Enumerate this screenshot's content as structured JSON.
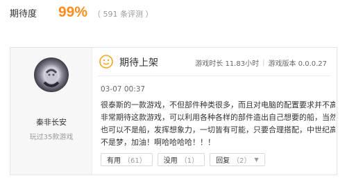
{
  "rating": {
    "label": "期待度",
    "value": "99%",
    "count_text": "（ 591 条评测 ）"
  },
  "review": {
    "user": {
      "name": "秦非长安",
      "played": "玩过35款游戏"
    },
    "status": "期待上架",
    "playtime": "游戏时长 11.83小时",
    "separator": "|",
    "version": "游戏版本 0.0.0.27",
    "date": "03-07 00:37",
    "content_lines": [
      "很泰斯的一款游戏，不但部件种类很多，而且对电脑的配置要求并不高，",
      "非常期待这款游戏，可以利用各种各样的部件造出自己想要的船，当然",
      "也可以不是船，发挥想象力，一切皆有可能，只要合理搭配，中世纪高达",
      "不是梦，加油！啊哈哈哈哈！！！"
    ],
    "buttons": {
      "useful_label": "有用",
      "useful_count": "（61）",
      "useless_label": "没用",
      "useless_count": "（1）",
      "reply_label": "回复",
      "reply_count": "（2）",
      "reply_icon": "chevron-down-icon"
    },
    "colors": {
      "accent": "#ff8c1a",
      "status_icon": "#f5a623"
    }
  }
}
